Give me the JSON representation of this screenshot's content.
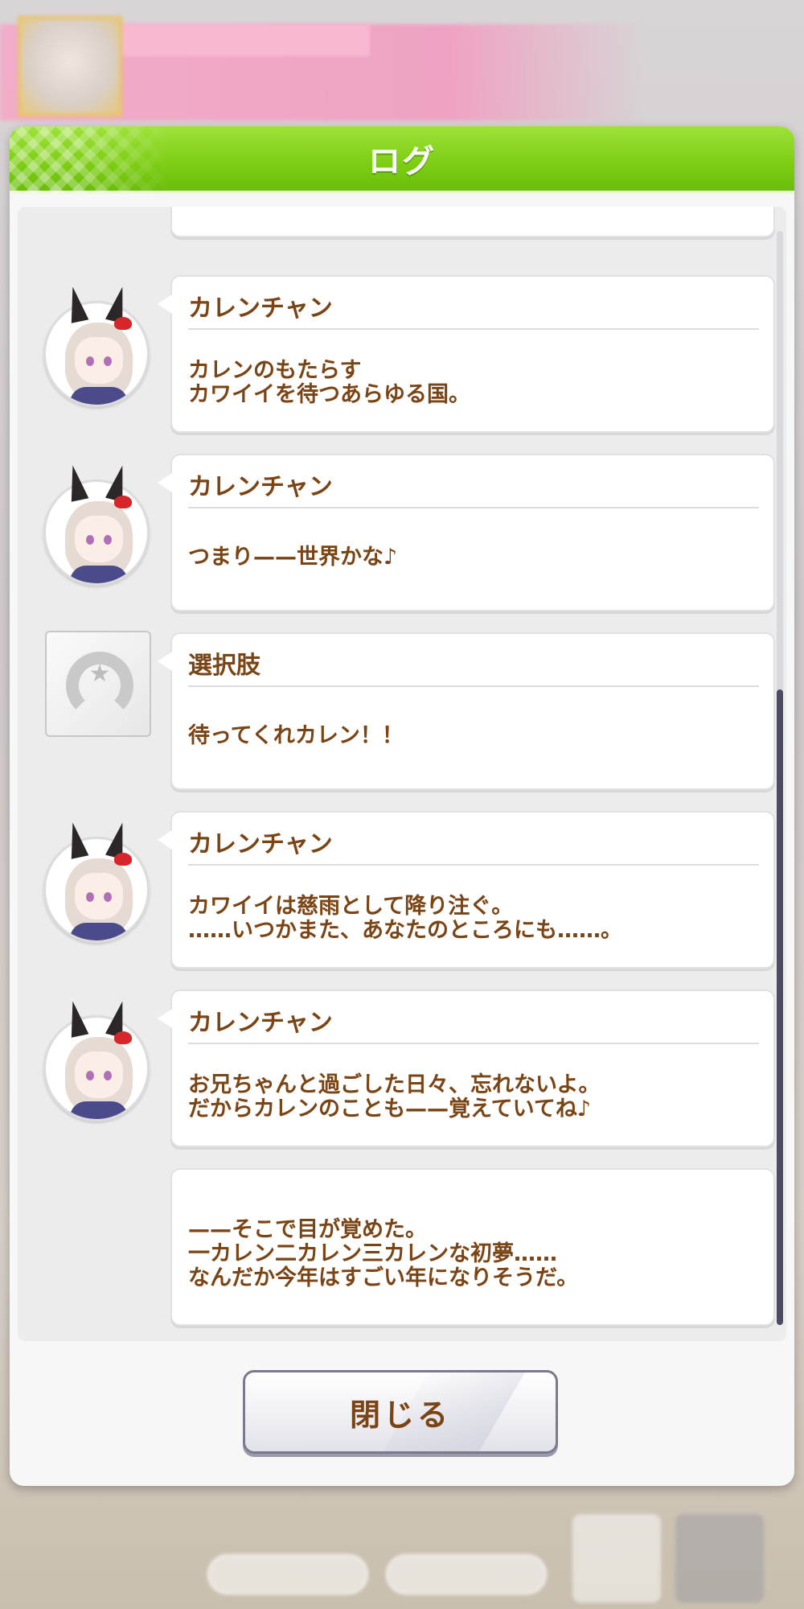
{
  "dialog": {
    "title": "ログ",
    "close_label": "閉じる"
  },
  "log": [
    {
      "type": "character",
      "speaker": "カレンチャン",
      "lines": [
        "カレンのもたらす",
        "カワイイを待つあらゆる国。"
      ]
    },
    {
      "type": "character",
      "speaker": "カレンチャン",
      "lines": [
        "つまり——世界かな♪"
      ]
    },
    {
      "type": "choice",
      "speaker": "選択肢",
      "lines": [
        "待ってくれカレン！！"
      ]
    },
    {
      "type": "character",
      "speaker": "カレンチャン",
      "lines": [
        "カワイイは慈雨として降り注ぐ。",
        "……いつかまた、あなたのところにも……。"
      ]
    },
    {
      "type": "character",
      "speaker": "カレンチャン",
      "lines": [
        "お兄ちゃんと過ごした日々、忘れないよ。",
        "だからカレンのことも——覚えていてね♪"
      ]
    },
    {
      "type": "narration",
      "speaker": "",
      "lines": [
        "——そこで目が覚めた。",
        "一カレン二カレン三カレンな初夢……",
        "なんだか今年はすごい年になりそうだ。"
      ]
    }
  ],
  "icons": {
    "character_avatar": "karen-chan-avatar",
    "choice_icon": "horseshoe-icon"
  },
  "colors": {
    "header_green": "#7ccd13",
    "text_brown": "#7b4414",
    "scroll_thumb": "#4b4b63"
  }
}
